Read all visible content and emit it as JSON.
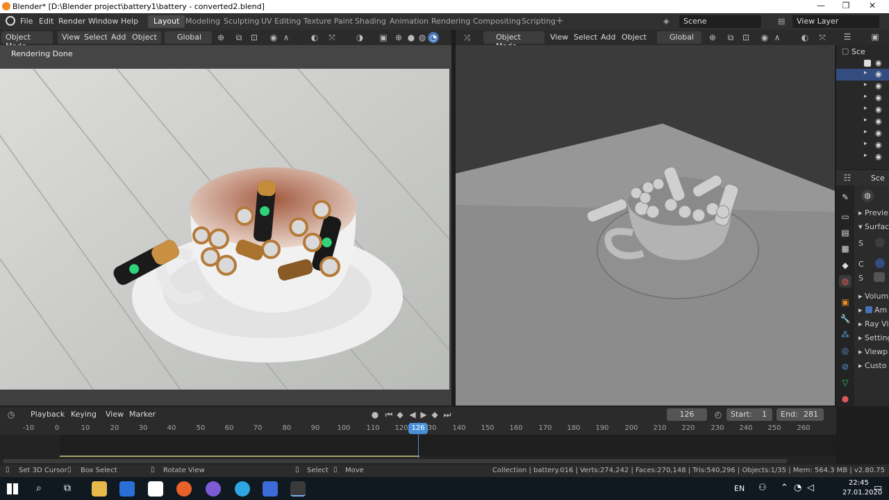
{
  "window": {
    "title": "Blender* [D:\\Blender project\\battery1\\battery - converted2.blend]",
    "controls": [
      "—",
      "❐",
      "✕"
    ]
  },
  "menu": [
    "File",
    "Edit",
    "Render",
    "Window",
    "Help"
  ],
  "workspaces": [
    "Layout",
    "Modeling",
    "Sculpting",
    "UV Editing",
    "Texture Paint",
    "Shading",
    "Animation",
    "Rendering",
    "Compositing",
    "Scripting"
  ],
  "active_workspace": "Layout",
  "scene_field": "Scene",
  "view_layer_field": "View Layer",
  "left_header": {
    "mode": "Object Mode",
    "menus": [
      "View",
      "Select",
      "Add",
      "Object"
    ],
    "orientation": "Global"
  },
  "right_header": {
    "mode": "Object Mode",
    "menus": [
      "View",
      "Select",
      "Add",
      "Object"
    ],
    "orientation": "Global"
  },
  "render_status": "Rendering Done",
  "outliner": {
    "header": "Sce"
  },
  "properties": {
    "header": "Sce",
    "items": [
      "Previe",
      "Surfac",
      "S",
      "C",
      "S",
      "Volum",
      "Am",
      "Ray Vi",
      "Setting",
      "Viewp",
      "Custo"
    ]
  },
  "timeline": {
    "menus": [
      "Playback",
      "Keying",
      "View",
      "Marker"
    ],
    "current_frame": "126",
    "start_label": "Start:",
    "start": "1",
    "end_label": "End:",
    "end": "281",
    "ticks": [
      "-10",
      "0",
      "10",
      "20",
      "30",
      "40",
      "50",
      "60",
      "70",
      "80",
      "90",
      "100",
      "110",
      "120",
      "126",
      "30",
      "140",
      "150",
      "160",
      "170",
      "180",
      "190",
      "200",
      "210",
      "220",
      "230",
      "240",
      "250",
      "260"
    ]
  },
  "status": {
    "hints": [
      "Set 3D Cursor",
      "Box Select",
      "Rotate View",
      "Select",
      "Move"
    ],
    "info": "Collection | battery.016 | Verts:274,242 | Faces:270,148 | Tris:540,296 | Objects:1/35 | Mem: 564.3 MB | v2.80.75"
  },
  "taskbar": {
    "lang": "EN",
    "time": "22:45",
    "date": "27.01.2020"
  },
  "colors": {
    "accent": "#4772b3",
    "active_row": "#334d80",
    "frame_marker": "#4a90d9"
  }
}
